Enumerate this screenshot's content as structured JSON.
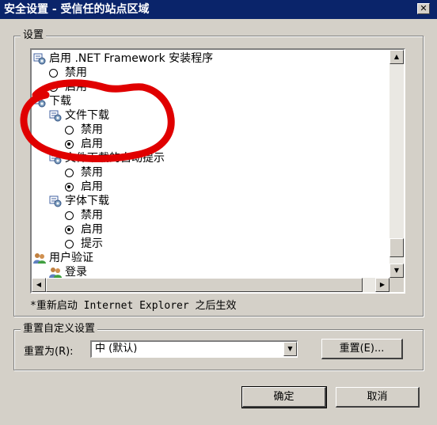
{
  "window": {
    "title": "安全设置 - 受信任的站点区域",
    "close_glyph": "✕"
  },
  "settings_group": {
    "label": "设置"
  },
  "tree": [
    {
      "type": "category",
      "label": "启用 .NET Framework 安装程序",
      "icon": "settings-gear-icon"
    },
    {
      "type": "option",
      "label": "禁用",
      "selected": false
    },
    {
      "type": "option",
      "label": "启用",
      "selected": true
    },
    {
      "type": "category",
      "label": "下载",
      "icon": "settings-gear-icon"
    },
    {
      "type": "subcategory",
      "label": "文件下载",
      "icon": "settings-gear-icon"
    },
    {
      "type": "option",
      "label": "禁用",
      "selected": false
    },
    {
      "type": "option",
      "label": "启用",
      "selected": true
    },
    {
      "type": "subcategory",
      "label": "文件下载的自动提示",
      "icon": "settings-gear-icon"
    },
    {
      "type": "option",
      "label": "禁用",
      "selected": false
    },
    {
      "type": "option",
      "label": "启用",
      "selected": true
    },
    {
      "type": "subcategory",
      "label": "字体下载",
      "icon": "settings-gear-icon"
    },
    {
      "type": "option",
      "label": "禁用",
      "selected": false
    },
    {
      "type": "option",
      "label": "启用",
      "selected": true
    },
    {
      "type": "option",
      "label": "提示",
      "selected": false
    },
    {
      "type": "category",
      "label": "用户验证",
      "icon": "users-icon"
    },
    {
      "type": "subcategory",
      "label": "登录",
      "icon": "users-icon"
    }
  ],
  "note": "*重新启动 Internet Explorer 之后生效",
  "reset_group": {
    "label": "重置自定义设置",
    "reset_to_label": "重置为(R):",
    "reset_to_value": "中 (默认)",
    "reset_button": "重置(E)..."
  },
  "footer": {
    "ok": "确定",
    "cancel": "取消"
  },
  "colors": {
    "titlebar": "#0a246a",
    "face": "#d4d0c8",
    "annotation": "#e00000"
  }
}
